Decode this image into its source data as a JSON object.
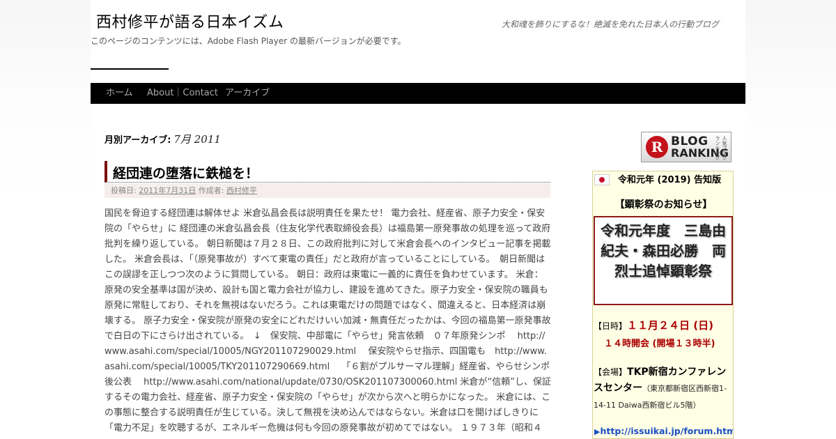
{
  "header": {
    "site_title": "西村修平が語る日本イズム",
    "description": "大和魂を飾りにするな！絶滅を免れた日本人の行動ブログ",
    "flash_notice": "このページのコンテンツには、Adobe Flash Player の最新バージョンが必要です。"
  },
  "nav": {
    "items": [
      {
        "label": "ホーム"
      },
      {
        "label": "About｜Contact"
      },
      {
        "label": "アーカイブ"
      }
    ]
  },
  "archive": {
    "label": "月別アーカイブ:",
    "value": "7月 2011"
  },
  "post": {
    "title": "経団連の堕落に鉄槌を！",
    "posted_label": "投稿日:",
    "date": "2011年7月31日",
    "author_label": "作成者:",
    "author": "西村修平",
    "body": "国民を脅迫する経団連は解体せよ 米倉弘昌会長は説明責任を果たせ！ 電力会社、経産省、原子力安全・保安院の「やらせ」に 経団連の米倉弘昌会長（住友化学代表取締役会長）は福島第一原発事故の処理を巡って政府批判を繰り返している。 朝日新聞は７月２８日、この政府批判に対して米倉会長へのインタビュー記事を掲載した。 米倉会長は、「（原発事故が）すべて東電の責任」だと政府が言っていることにしている。　朝日新聞はこの誤謬を正しつつ次のように質問している。 朝日：政府は東電に一義的に責任を負わせています。 米倉：原発の安全基準は国が決め、設計も国と電力会社が協力し、建設を進めてきた。原子力安全・保安院の職員も原発に常駐しており、それを無視はないだろう。これは東電だけの問題ではなく、間違えると、日本経済は崩壊する。 原子力安全・保安院が原発の安全にどれだけいい加減・無責任だったかは、今回の福島第一原発事故で白日の下にさらけ出されている。　↓　保安院、中部電に「やらせ」発言依頼　０７年原発シンポ　 http://www.asahi.com/special/10005/NGY201107290029.html　 保安院やらせ指示、四国電も　http://www.asahi.com/special/10005/TKY201107290669.html　 「６割がプルサーマル理解」経産省、やらせシンポ後公表　 http://www.asahi.com/national/update/0730/OSK201107300060.html 米倉が“信頼”し、保証するその電力会社、経産省、原子力安全・保安院の「やらせ」が次から次へと明らかになった。 米倉には、この事態に整合する説明責任が生じている。決して無視を決め込んではならない。米倉は口を開けばしきりに「電力不足」を吹聴するが、エネルギー危機は何も今回の原発事故が初めてではない。 １９７３年（昭和４"
  },
  "sidebar": {
    "ranking": {
      "circle": "R",
      "line1": "BLOG",
      "line2": "RANKING",
      "sub": "人気ブログランキング"
    },
    "notice": {
      "heading": "令和元年 (2019) 告知版",
      "title": "【顕彰祭のお知らせ】",
      "event_name": "令和元年度　三島由紀夫・森田必勝　両烈士追悼顕彰祭",
      "date_label": "【日時】",
      "date_value": "１１月２４日 (日)",
      "time": "１４時開会 (開場１３時半)",
      "venue_label": "【会場】",
      "venue_name": "TKP新宿カンファレンスセンター",
      "venue_address": "（東京都新宿区西新宿1-14-11 Daiwa西新宿ビル5階）",
      "link_arrow": "▶",
      "link": "http://issuikai.jp/forum.html"
    }
  }
}
